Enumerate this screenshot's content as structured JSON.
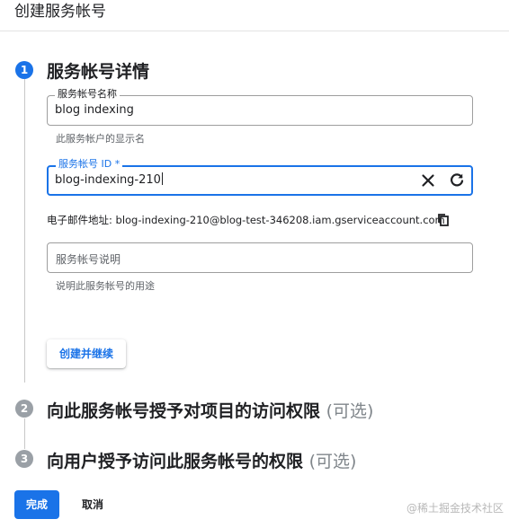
{
  "header": {
    "title": "创建服务帐号"
  },
  "steps": [
    {
      "number": "1",
      "title": "服务帐号详情",
      "optional": ""
    },
    {
      "number": "2",
      "title": "向此服务帐号授予对项目的访问权限",
      "optional": "(可选)"
    },
    {
      "number": "3",
      "title": "向用户授予访问此服务帐号的权限",
      "optional": "(可选)"
    }
  ],
  "form": {
    "name_field": {
      "label": "服务帐号名称",
      "value": "blog indexing",
      "hint": "此服务帐户的显示名"
    },
    "id_field": {
      "label": "服务帐号 ID *",
      "value": "blog-indexing-210",
      "clear_icon": "close-icon",
      "refresh_icon": "refresh-icon"
    },
    "email": {
      "label": "电子邮件地址:",
      "value": "blog-indexing-210@blog-test-346208.iam.gserviceaccount.com",
      "copy_icon": "copy-icon"
    },
    "description_field": {
      "placeholder": "服务帐号说明",
      "hint": "说明此服务帐号的用途"
    },
    "continue_label": "创建并继续"
  },
  "footer": {
    "done_label": "完成",
    "cancel_label": "取消"
  },
  "watermark": "@稀土掘金技术社区",
  "colors": {
    "accent": "#1a73e8",
    "inactive_step": "#9aa0a6"
  }
}
